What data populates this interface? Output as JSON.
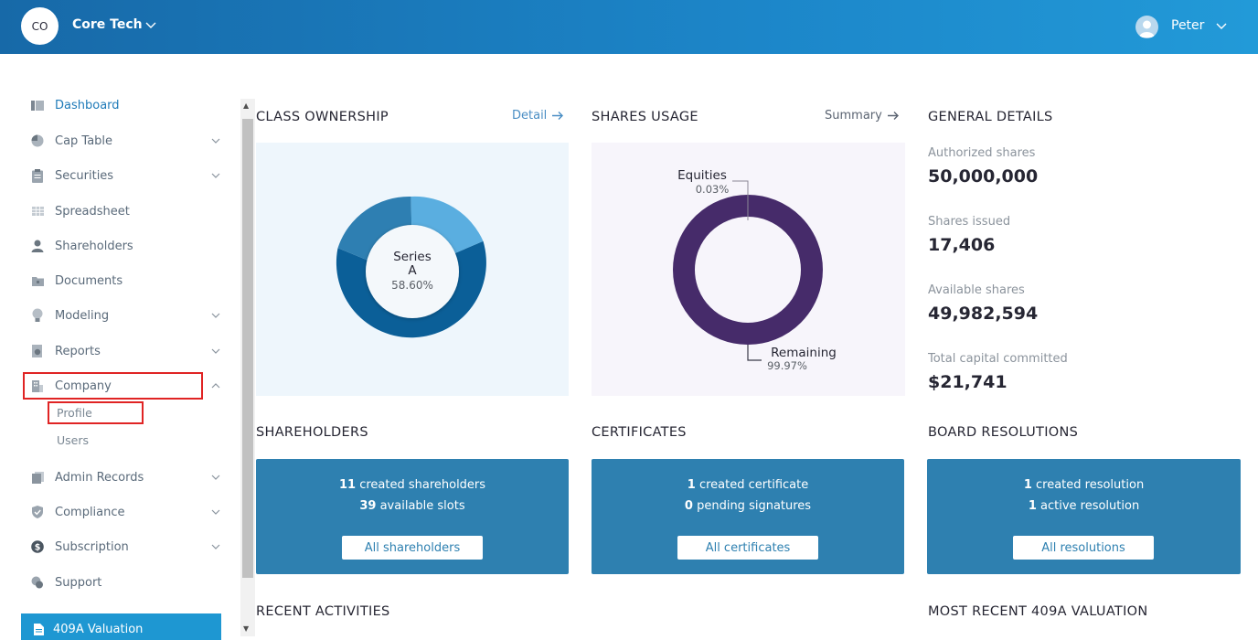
{
  "header": {
    "logo_initials": "CO",
    "company_name": "Core Tech",
    "user_name": "Peter"
  },
  "sidebar": {
    "items": [
      {
        "label": "Dashboard",
        "icon": "dashboard-icon",
        "has_chevron": false,
        "active": true
      },
      {
        "label": "Cap Table",
        "icon": "pie-chart-icon",
        "has_chevron": true
      },
      {
        "label": "Securities",
        "icon": "clipboard-icon",
        "has_chevron": true
      },
      {
        "label": "Spreadsheet",
        "icon": "spreadsheet-icon",
        "has_chevron": false
      },
      {
        "label": "Shareholders",
        "icon": "user-icon",
        "has_chevron": false
      },
      {
        "label": "Documents",
        "icon": "folder-icon",
        "has_chevron": false
      },
      {
        "label": "Modeling",
        "icon": "lightbulb-icon",
        "has_chevron": true
      },
      {
        "label": "Reports",
        "icon": "report-icon",
        "has_chevron": true
      },
      {
        "label": "Company",
        "icon": "building-icon",
        "has_chevron": true,
        "expanded": true
      },
      {
        "label": "Admin Records",
        "icon": "records-icon",
        "has_chevron": true
      },
      {
        "label": "Compliance",
        "icon": "shield-icon",
        "has_chevron": true
      },
      {
        "label": "Subscription",
        "icon": "dollar-icon",
        "has_chevron": true
      },
      {
        "label": "Support",
        "icon": "support-icon",
        "has_chevron": false
      }
    ],
    "company_sub_items": [
      "Profile",
      "Users"
    ],
    "valuation_button": "409A Valuation"
  },
  "class_ownership": {
    "title": "CLASS OWNERSHIP",
    "link": "Detail",
    "center_label_1": "Series",
    "center_label_2": "A",
    "center_value": "58.60%",
    "colors": {
      "series_a": "#0b5f98",
      "other_1": "#2e7fb2",
      "other_2": "#5aaee0",
      "panel": "#eef6fc"
    }
  },
  "shares_usage": {
    "title": "SHARES USAGE",
    "link": "Summary",
    "equities_label": "Equities",
    "equities_value": "0.03%",
    "remaining_label": "Remaining",
    "remaining_value": "99.97%",
    "colors": {
      "ring": "#462b6a",
      "panel": "#f7f5fb"
    }
  },
  "general_details": {
    "title": "GENERAL DETAILS",
    "rows": [
      {
        "label": "Authorized shares",
        "value": "50,000,000"
      },
      {
        "label": "Shares issued",
        "value": "17,406"
      },
      {
        "label": "Available shares",
        "value": "49,982,594"
      },
      {
        "label": "Total capital committed",
        "value": "$21,741"
      }
    ]
  },
  "shareholders": {
    "title": "SHAREHOLDERS",
    "line1_count": "11",
    "line1_text": "created shareholders",
    "line2_count": "39",
    "line2_text": "available slots",
    "button": "All shareholders"
  },
  "certificates": {
    "title": "CERTIFICATES",
    "line1_count": "1",
    "line1_text": "created certificate",
    "line2_count": "0",
    "line2_text": "pending signatures",
    "button": "All certificates"
  },
  "board_resolutions": {
    "title": "BOARD RESOLUTIONS",
    "line1_count": "1",
    "line1_text": "created resolution",
    "line2_count": "1",
    "line2_text": "active resolution",
    "button": "All resolutions"
  },
  "recent_activities": {
    "title": "RECENT ACTIVITIES"
  },
  "valuation_409a": {
    "title": "MOST RECENT 409A VALUATION"
  }
}
